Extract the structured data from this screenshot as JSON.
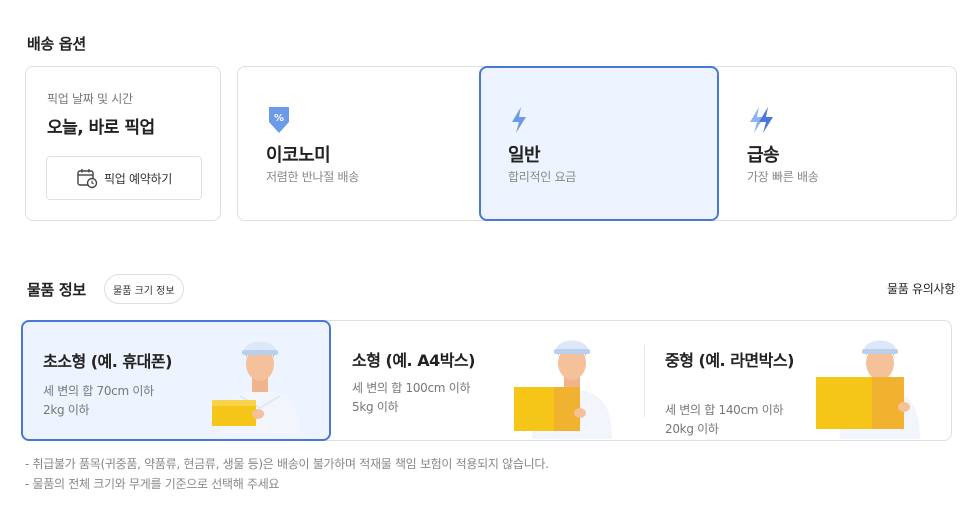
{
  "delivery": {
    "title": "배송 옵션",
    "pickup": {
      "sublabel": "픽업 날짜 및 시간",
      "value": "오늘, 바로 픽업",
      "reserve_label": "픽업 예약하기"
    },
    "speeds": [
      {
        "name": "이코노미",
        "desc": "저렴한 반나절 배송",
        "icon": "discount-tag-icon",
        "selected": false
      },
      {
        "name": "일반",
        "desc": "합리적인 요금",
        "icon": "lightning-icon",
        "selected": true
      },
      {
        "name": "급송",
        "desc": "가장 빠른 배송",
        "icon": "double-lightning-icon",
        "selected": false
      }
    ]
  },
  "item": {
    "title": "물품 정보",
    "size_info_label": "물품 크기 정보",
    "notes_label": "물품 유의사항",
    "sizes": [
      {
        "name": "초소형 (예. 휴대폰)",
        "desc": "세 변의 합 70cm 이하 2kg 이하",
        "selected": true
      },
      {
        "name": "소형 (예. A4박스)",
        "desc": "세 변의 합 100cm 이하 5kg 이하",
        "selected": false
      },
      {
        "name": "중형 (예. 라면박스)",
        "desc": "세 변의 합 140cm 이하 20kg 이하",
        "selected": false
      }
    ]
  },
  "notices": [
    "- 취급불가 품목(귀중품, 약품류, 현금류, 생물 등)은 배송이 불가하며 적재물 책임 보험이 적용되지 않습니다.",
    "- 물품의 전체 크기와 무게를 기준으로 선택해 주세요"
  ],
  "colors": {
    "accent": "#4a78d8",
    "selected_bg": "#eef4ff",
    "icon_blue": "#6b9be8",
    "box_yellow": "#f5c518"
  }
}
